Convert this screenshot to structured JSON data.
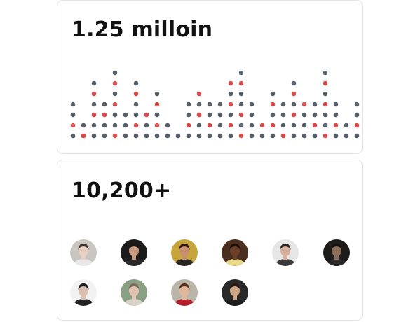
{
  "stats": {
    "listens": "1.25 milloin",
    "members": "10,200+"
  },
  "dot_matrix": {
    "colors": {
      "dark": "#56606a",
      "red": "#d94b4b"
    },
    "columns": [
      [
        "d",
        "r",
        "d",
        "d"
      ],
      [
        "r",
        "d"
      ],
      [
        "d",
        "d",
        "r",
        "d",
        "r",
        "d"
      ],
      [
        "d",
        "d",
        "r",
        "d"
      ],
      [
        "r",
        "d",
        "d",
        "r",
        "d",
        "r",
        "d"
      ],
      [
        "d",
        "d",
        "d"
      ],
      [
        "d",
        "r",
        "d",
        "d",
        "r",
        "d"
      ],
      [
        "d",
        "d",
        "r"
      ],
      [
        "d",
        "r",
        "d",
        "r",
        "d"
      ],
      [
        "d",
        "d"
      ],
      [
        "d"
      ],
      [
        "d",
        "r",
        "d",
        "d"
      ],
      [
        "d",
        "d",
        "r",
        "d",
        "r"
      ],
      [
        "d",
        "r",
        "d",
        "d"
      ],
      [
        "d",
        "d",
        "d",
        "d"
      ],
      [
        "d",
        "r",
        "d",
        "r",
        "d",
        "r"
      ],
      [
        "r",
        "d",
        "r",
        "d",
        "d",
        "r",
        "d"
      ],
      [
        "d",
        "d",
        "d",
        "d"
      ],
      [
        "d",
        "r"
      ],
      [
        "d",
        "r",
        "d",
        "r",
        "d"
      ],
      [
        "r",
        "d",
        "d",
        "d"
      ],
      [
        "d",
        "d",
        "r",
        "d",
        "r",
        "d"
      ],
      [
        "d",
        "d",
        "d",
        "r"
      ],
      [
        "d",
        "r",
        "d",
        "d"
      ],
      [
        "r",
        "d",
        "d",
        "r",
        "d",
        "r",
        "d"
      ],
      [
        "d",
        "r",
        "d",
        "d"
      ],
      [
        "d",
        "d"
      ],
      [
        "d",
        "r",
        "d",
        "d"
      ]
    ]
  },
  "avatars": [
    {
      "name": "avatar-1",
      "bg": "#c9c6c1",
      "skin": "#e9d2c4",
      "hair": "#3c2f2a",
      "shirt": "#e8e8e8"
    },
    {
      "name": "avatar-2",
      "bg": "#1b1b1b",
      "skin": "#c89b80",
      "hair": "#1e1410",
      "shirt": "#2a2a2a"
    },
    {
      "name": "avatar-3",
      "bg": "#c7a53d",
      "skin": "#c8906e",
      "hair": "#2a160f",
      "shirt": "#2b2521"
    },
    {
      "name": "avatar-4",
      "bg": "#4a2e1e",
      "skin": "#6b3f28",
      "hair": "#1a0f0b",
      "shirt": "#e9d98a"
    },
    {
      "name": "avatar-5",
      "bg": "#e6e6e6",
      "skin": "#d6b09b",
      "hair": "#2a2220",
      "shirt": "#3a3a3a"
    },
    {
      "name": "avatar-6",
      "bg": "#1e1c1a",
      "skin": "#8c6d5a",
      "hair": "#141110",
      "shirt": "#2c2a28"
    },
    {
      "name": "avatar-7",
      "bg": "#f2f2f2",
      "skin": "#d9c0b0",
      "hair": "#1a1a1a",
      "shirt": "#222222"
    },
    {
      "name": "avatar-8",
      "bg": "#8aa085",
      "skin": "#e2c3b1",
      "hair": "#7d6a5b",
      "shirt": "#d8d2c8"
    },
    {
      "name": "avatar-9",
      "bg": "#b9b5a8",
      "skin": "#e0b89e",
      "hair": "#5a2d1a",
      "shirt": "#b3202b"
    },
    {
      "name": "avatar-10",
      "bg": "#2a2a2a",
      "skin": "#cfa588",
      "hair": "#2a1a12",
      "shirt": "#1c1c1c"
    }
  ]
}
